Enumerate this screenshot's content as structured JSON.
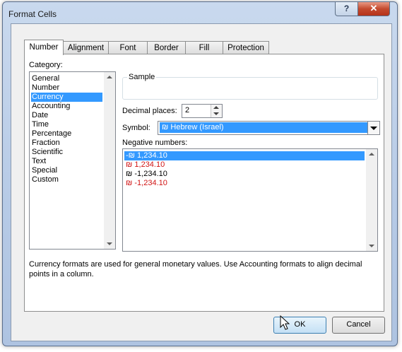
{
  "window": {
    "title": "Format Cells",
    "help_label": "?",
    "close_label": "✕"
  },
  "tabs": [
    {
      "label": "Number",
      "active": true
    },
    {
      "label": "Alignment",
      "active": false
    },
    {
      "label": "Font",
      "active": false
    },
    {
      "label": "Border",
      "active": false
    },
    {
      "label": "Fill",
      "active": false
    },
    {
      "label": "Protection",
      "active": false
    }
  ],
  "category": {
    "label": "Category:",
    "items": [
      "General",
      "Number",
      "Currency",
      "Accounting",
      "Date",
      "Time",
      "Percentage",
      "Fraction",
      "Scientific",
      "Text",
      "Special",
      "Custom"
    ],
    "selected": "Currency"
  },
  "sample": {
    "label": "Sample"
  },
  "decimal": {
    "label": "Decimal places:",
    "value": "2"
  },
  "symbol": {
    "label": "Symbol:",
    "value": "₪ Hebrew (Israel)"
  },
  "negative": {
    "label": "Negative numbers:",
    "items": [
      {
        "text": "-₪ 1,234.10",
        "red": false,
        "selected": true
      },
      {
        "text": "₪ 1,234.10",
        "red": true,
        "selected": false
      },
      {
        "text": "₪ -1,234.10",
        "red": false,
        "selected": false
      },
      {
        "text": "₪ -1,234.10",
        "red": true,
        "selected": false
      }
    ]
  },
  "description": "Currency formats are used for general monetary values.  Use Accounting formats to align decimal points in a column.",
  "buttons": {
    "ok": "OK",
    "cancel": "Cancel"
  },
  "colors": {
    "selection": "#3399ff",
    "negative_red": "#d11414"
  }
}
